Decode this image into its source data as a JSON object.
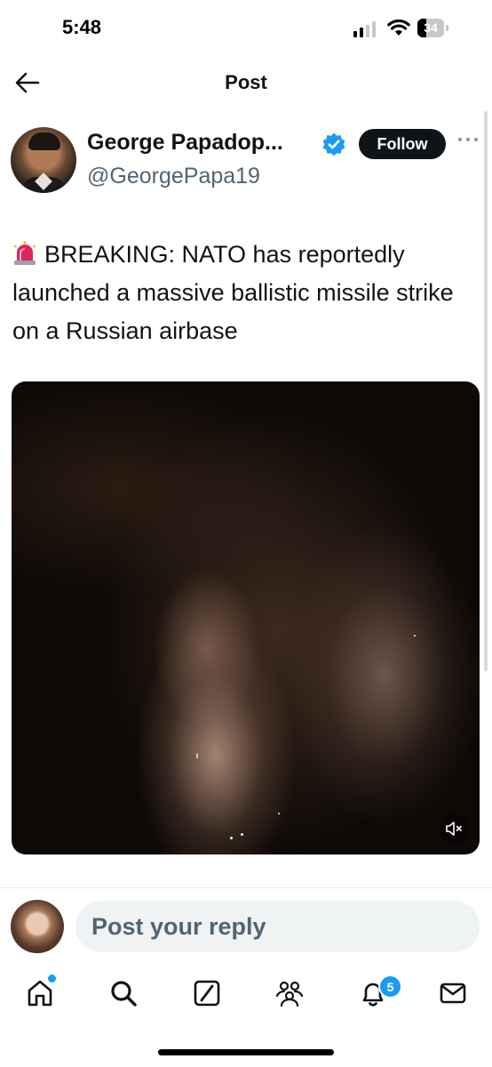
{
  "status_bar": {
    "time": "5:48",
    "battery_level": "34",
    "battery_fraction": 0.34
  },
  "header": {
    "title": "Post"
  },
  "author": {
    "name": "George Papadop...",
    "handle": "@GeorgePapa19",
    "verified": true,
    "follow_label": "Follow"
  },
  "tweet": {
    "emoji_icon": "police-light-icon",
    "text": "BREAKING: NATO has reportedly launched a massive ballistic missile strike on a Russian airbase"
  },
  "media": {
    "type": "video",
    "muted": true
  },
  "reply": {
    "placeholder": "Post your reply"
  },
  "nav": {
    "items": [
      "home-icon",
      "search-icon",
      "grok-icon",
      "communities-icon",
      "notifications-icon",
      "messages-icon"
    ],
    "notifications_count": "5"
  },
  "colors": {
    "accent": "#1d9bf0",
    "text": "#0f1419",
    "muted": "#536471"
  }
}
